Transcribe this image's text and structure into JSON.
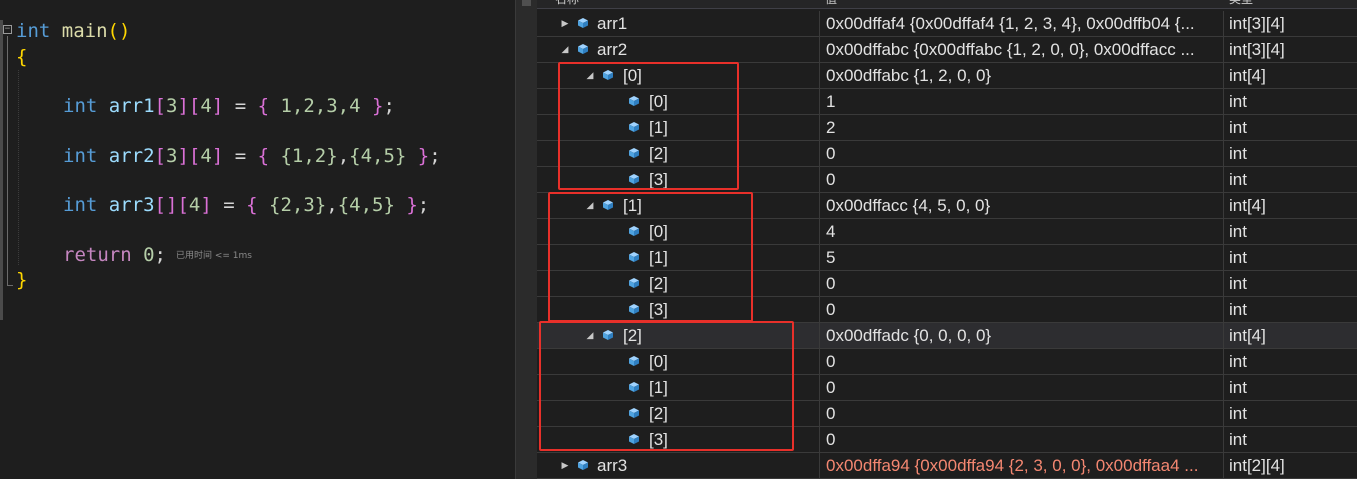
{
  "code": {
    "fold_glyph": "−",
    "line1": {
      "kw": "int",
      "fn": "main",
      "parens": "()"
    },
    "line2": {
      "brace": "{"
    },
    "line3": {
      "kw": "int",
      "ident": "arr1",
      "dims": [
        "[",
        "3",
        "]",
        "[",
        "4",
        "]"
      ],
      "rest": " = ",
      "init": [
        "{",
        " 1,2,3,4 ",
        "}"
      ],
      "semi": ";"
    },
    "line4": {
      "kw": "int",
      "ident": "arr2",
      "dims": [
        "[",
        "3",
        "]",
        "[",
        "4",
        "]"
      ],
      "rest": " = ",
      "ob": "{",
      "inner1": " {1,2}",
      "sep": ",",
      "inner2": "{4,5}",
      "cb": " }",
      "semi": ";"
    },
    "line5": {
      "kw": "int",
      "ident": "arr3",
      "dims": [
        "[",
        "]",
        "[",
        "4",
        "]"
      ],
      "rest": " = ",
      "ob": "{",
      "inner1": " {2,3}",
      "sep": ",",
      "inner2": "{4,5}",
      "cb": " }",
      "semi": ";"
    },
    "line6": {
      "kw": "return",
      "num": "0",
      "semi": ";",
      "hint": "已用时间 <= 1ms"
    },
    "line7": {
      "brace": "}"
    }
  },
  "watch": {
    "columns": {
      "name": "名称",
      "value": "值",
      "type": "类型"
    },
    "rows": [
      {
        "id": "arr1",
        "name": "arr1",
        "value": "0x00dffaf4 {0x00dffaf4 {1, 2, 3, 4}, 0x00dffb04 {...",
        "type": "int[3][4]",
        "expander": "▶",
        "depth": 0
      },
      {
        "id": "arr2",
        "name": "arr2",
        "value": "0x00dffabc {0x00dffabc {1, 2, 0, 0}, 0x00dffacc ...",
        "type": "int[3][4]",
        "expander": "◢",
        "depth": 0
      },
      {
        "id": "arr2-0",
        "name": "[0]",
        "value": "0x00dffabc {1, 2, 0, 0}",
        "type": "int[4]",
        "expander": "◢",
        "depth": 1
      },
      {
        "id": "arr2-0-0",
        "name": "[0]",
        "value": "1",
        "type": "int",
        "expander": "",
        "depth": 2
      },
      {
        "id": "arr2-0-1",
        "name": "[1]",
        "value": "2",
        "type": "int",
        "expander": "",
        "depth": 2
      },
      {
        "id": "arr2-0-2",
        "name": "[2]",
        "value": "0",
        "type": "int",
        "expander": "",
        "depth": 2
      },
      {
        "id": "arr2-0-3",
        "name": "[3]",
        "value": "0",
        "type": "int",
        "expander": "",
        "depth": 2
      },
      {
        "id": "arr2-1",
        "name": "[1]",
        "value": "0x00dffacc {4, 5, 0, 0}",
        "type": "int[4]",
        "expander": "◢",
        "depth": 1
      },
      {
        "id": "arr2-1-0",
        "name": "[0]",
        "value": "4",
        "type": "int",
        "expander": "",
        "depth": 2
      },
      {
        "id": "arr2-1-1",
        "name": "[1]",
        "value": "5",
        "type": "int",
        "expander": "",
        "depth": 2
      },
      {
        "id": "arr2-1-2",
        "name": "[2]",
        "value": "0",
        "type": "int",
        "expander": "",
        "depth": 2
      },
      {
        "id": "arr2-1-3",
        "name": "[3]",
        "value": "0",
        "type": "int",
        "expander": "",
        "depth": 2
      },
      {
        "id": "arr2-2",
        "name": "[2]",
        "value": "0x00dffadc {0, 0, 0, 0}",
        "type": "int[4]",
        "expander": "◢",
        "depth": 1,
        "selected": true
      },
      {
        "id": "arr2-2-0",
        "name": "[0]",
        "value": "0",
        "type": "int",
        "expander": "",
        "depth": 2
      },
      {
        "id": "arr2-2-1",
        "name": "[1]",
        "value": "0",
        "type": "int",
        "expander": "",
        "depth": 2
      },
      {
        "id": "arr2-2-2",
        "name": "[2]",
        "value": "0",
        "type": "int",
        "expander": "",
        "depth": 2
      },
      {
        "id": "arr2-2-3",
        "name": "[3]",
        "value": "0",
        "type": "int",
        "expander": "",
        "depth": 2
      },
      {
        "id": "arr3",
        "name": "arr3",
        "value": "0x00dffa94 {0x00dffa94 {2, 3, 0, 0}, 0x00dffaa4 ...",
        "type": "int[2][4]",
        "expander": "▶",
        "depth": 0,
        "changed": true
      }
    ]
  },
  "colors": {
    "highlight_box": "#e8302a",
    "changed_value": "#f48771",
    "cube_icon": "#4fa3e0"
  },
  "icons": {
    "variable": "cube-icon",
    "expand": "triangle-right-icon",
    "collapse": "triangle-down-icon",
    "fold": "collapse-minus-icon"
  }
}
